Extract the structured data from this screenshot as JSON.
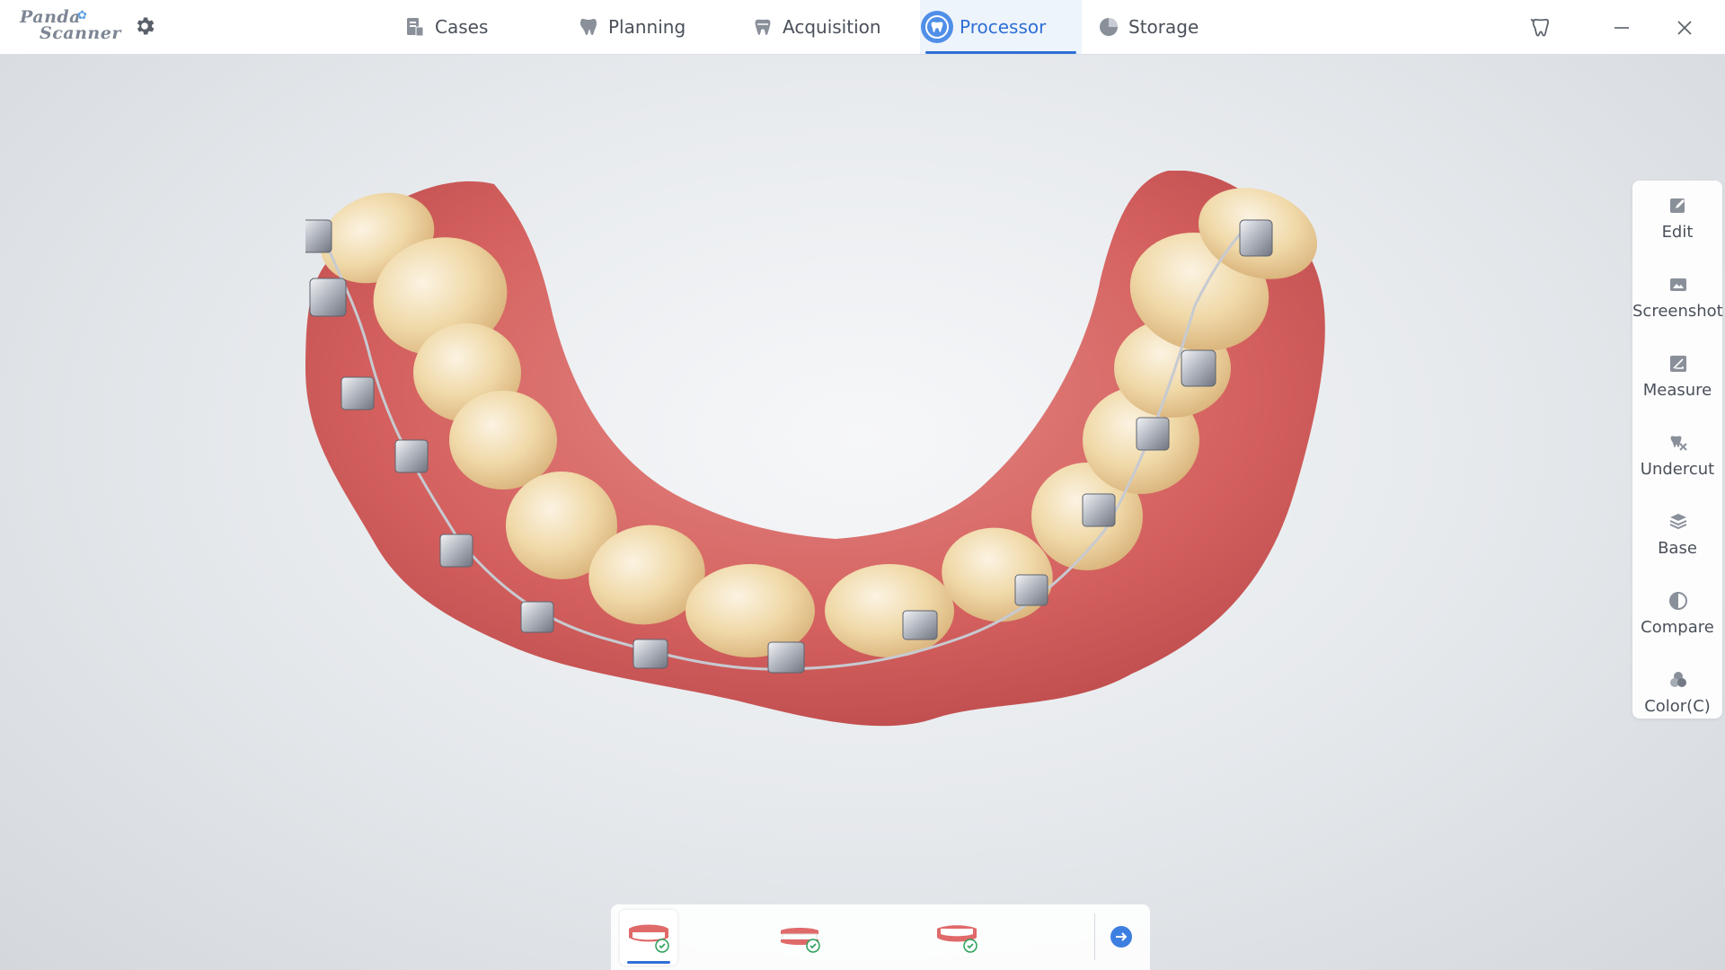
{
  "app": {
    "logo_line1": "Panda",
    "logo_line2": "Scanner"
  },
  "nav": {
    "items": [
      {
        "id": "cases",
        "label": "Cases",
        "icon": "cases-icon"
      },
      {
        "id": "planning",
        "label": "Planning",
        "icon": "planning-icon"
      },
      {
        "id": "acquisition",
        "label": "Acquisition",
        "icon": "acquisition-icon"
      },
      {
        "id": "processor",
        "label": "Processor",
        "icon": "processor-icon",
        "active": true
      },
      {
        "id": "storage",
        "label": "Storage",
        "icon": "storage-icon"
      }
    ]
  },
  "tools": {
    "items": [
      {
        "label": "Edit",
        "icon": "edit-icon"
      },
      {
        "label": "Screenshot",
        "icon": "screenshot-icon"
      },
      {
        "label": "Measure",
        "icon": "measure-icon"
      },
      {
        "label": "Undercut",
        "icon": "undercut-icon"
      },
      {
        "label": "Base",
        "icon": "base-icon"
      },
      {
        "label": "Compare",
        "icon": "compare-icon"
      },
      {
        "label": "Color(C)",
        "icon": "color-icon"
      }
    ]
  },
  "jaws": {
    "items": [
      {
        "icon": "upper-jaw-icon",
        "status": "done",
        "active": true
      },
      {
        "icon": "bite-jaw-icon",
        "status": "done"
      },
      {
        "icon": "lower-jaw-icon",
        "status": "done"
      }
    ],
    "next_icon": "arrow-right-icon"
  },
  "colors": {
    "accent": "#2f6fd6",
    "check": "#2aa05a",
    "gum": "#d66a6a",
    "tooth": "#f2dcb0"
  }
}
